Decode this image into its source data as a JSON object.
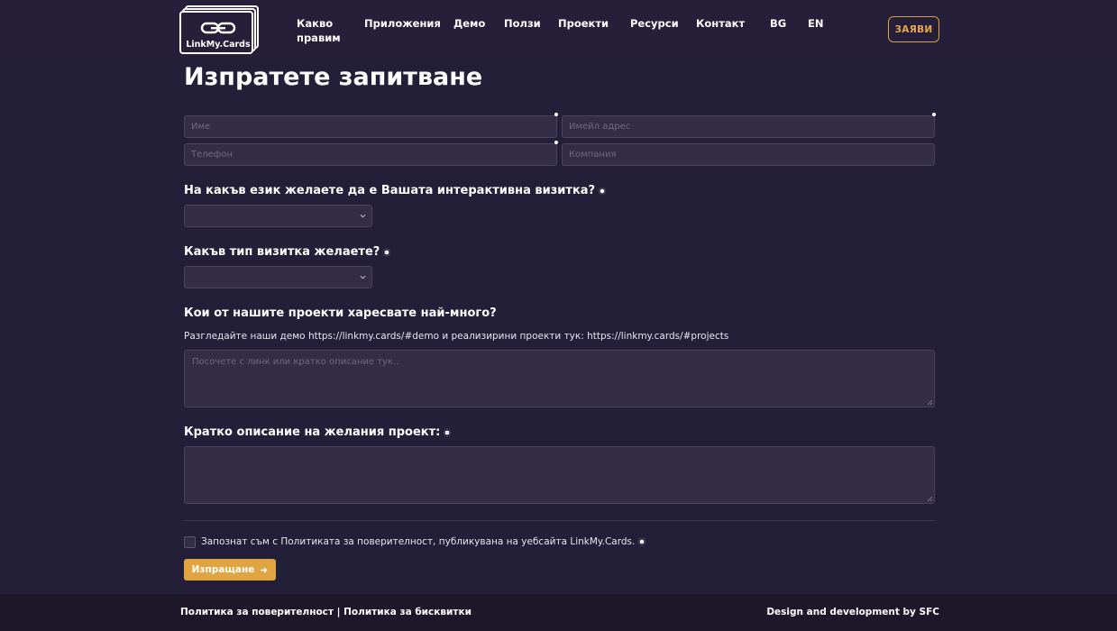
{
  "header": {
    "logo_text": "LinkMy.Cards",
    "nav": [
      {
        "label_line1": "Какво",
        "label_line2": "правим"
      },
      {
        "label": "Приложения"
      },
      {
        "label": "Демо"
      },
      {
        "label": "Ползи"
      },
      {
        "label": "Проекти"
      },
      {
        "label": "Ресурси"
      },
      {
        "label": "Контакт"
      },
      {
        "label": "BG"
      },
      {
        "label": "EN"
      }
    ],
    "apply_label": "ЗАЯВИ"
  },
  "form": {
    "title": "Изпратете запитване",
    "name_placeholder": "Име",
    "email_placeholder": "Имейл адрес",
    "phone_placeholder": "Телефон",
    "company_placeholder": "Компания",
    "language_question": "На какъв език желаете да е Вашата интерактивна визитка?",
    "language_value": "",
    "type_question": "Какъв тип визитка желаете?",
    "type_value": "",
    "projects_question": "Кои от нашите проекти харесвате най-много?",
    "projects_hint": "Разгледайте наши демо https://linkmy.cards/#demo и реализирини проекти тук: https://linkmy.cards/#projects",
    "projects_placeholder": "Посочете с линк или кратко описание тук..",
    "description_question": "Кратко описание на желания проект:",
    "consent_text": "Запознат съм с Политиката за поверителност, публикувана на уебсайта LinkMy.Cards.",
    "submit_label": "Изпращане"
  },
  "footer": {
    "privacy_label": "Политика за поверителност",
    "separator": "|",
    "cookies_label": "Политика за бисквитки",
    "credit": "Design and development by SFC"
  },
  "colors": {
    "background": "#231f38",
    "accent": "#e0a442",
    "footer": "#1c1829"
  }
}
